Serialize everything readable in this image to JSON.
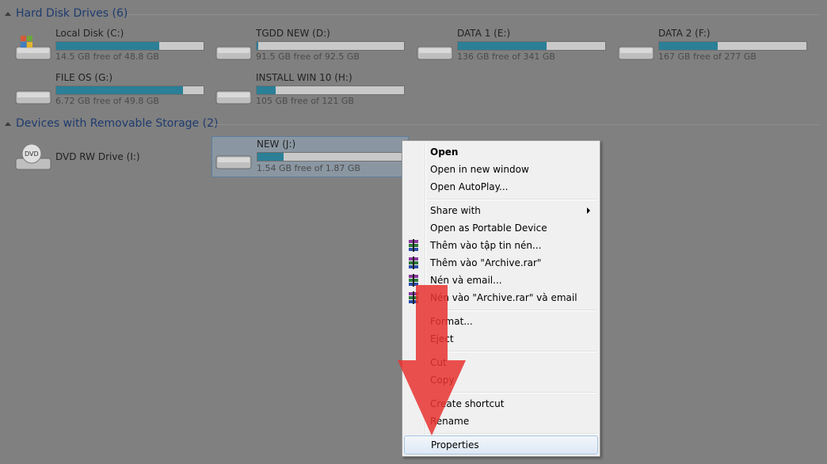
{
  "groups": {
    "hdd": {
      "title": "Hard Disk Drives (6)"
    },
    "removable": {
      "title": "Devices with Removable Storage (2)"
    }
  },
  "drives": [
    {
      "name": "Local Disk (C:)",
      "free": "14.5 GB free of 48.8 GB",
      "used_fraction": 0.7,
      "icon": "system-drive-icon"
    },
    {
      "name": "TGDD NEW (D:)",
      "free": "91.5 GB free of 92.5 GB",
      "used_fraction": 0.01,
      "icon": "hard-drive-icon"
    },
    {
      "name": "DATA 1 (E:)",
      "free": "136 GB free of 341 GB",
      "used_fraction": 0.6,
      "icon": "hard-drive-icon"
    },
    {
      "name": "DATA 2 (F:)",
      "free": "167 GB free of 277 GB",
      "used_fraction": 0.4,
      "icon": "hard-drive-icon"
    },
    {
      "name": "FILE OS (G:)",
      "free": "6.72 GB free of 49.8 GB",
      "used_fraction": 0.86,
      "icon": "hard-drive-icon"
    },
    {
      "name": "INSTALL WIN 10 (H:)",
      "free": "105 GB free of 121 GB",
      "used_fraction": 0.13,
      "icon": "hard-drive-icon"
    }
  ],
  "removable": [
    {
      "name": "DVD RW Drive (I:)",
      "icon": "dvd-drive-icon"
    },
    {
      "name": "NEW (J:)",
      "free": "1.54 GB free of 1.87 GB",
      "used_fraction": 0.18,
      "icon": "usb-drive-icon"
    }
  ],
  "context_menu": {
    "open": "Open",
    "open_new_window": "Open in new window",
    "open_autoplay": "Open AutoPlay...",
    "share_with": "Share with",
    "open_portable": "Open as Portable Device",
    "winrar_add": "Thêm vào tập tin nén...",
    "winrar_add_archive": "Thêm vào \"Archive.rar\"",
    "winrar_compress_email": "Nén và email...",
    "winrar_compress_archive_email": "Nén vào \"Archive.rar\" và email",
    "format": "Format...",
    "eject": "Eject",
    "cut": "Cut",
    "copy": "Copy",
    "create_shortcut": "Create shortcut",
    "rename": "Rename",
    "properties": "Properties"
  },
  "colors": {
    "bar_fill": "#2b7f97",
    "annotation_arrow": "#e8322f"
  }
}
